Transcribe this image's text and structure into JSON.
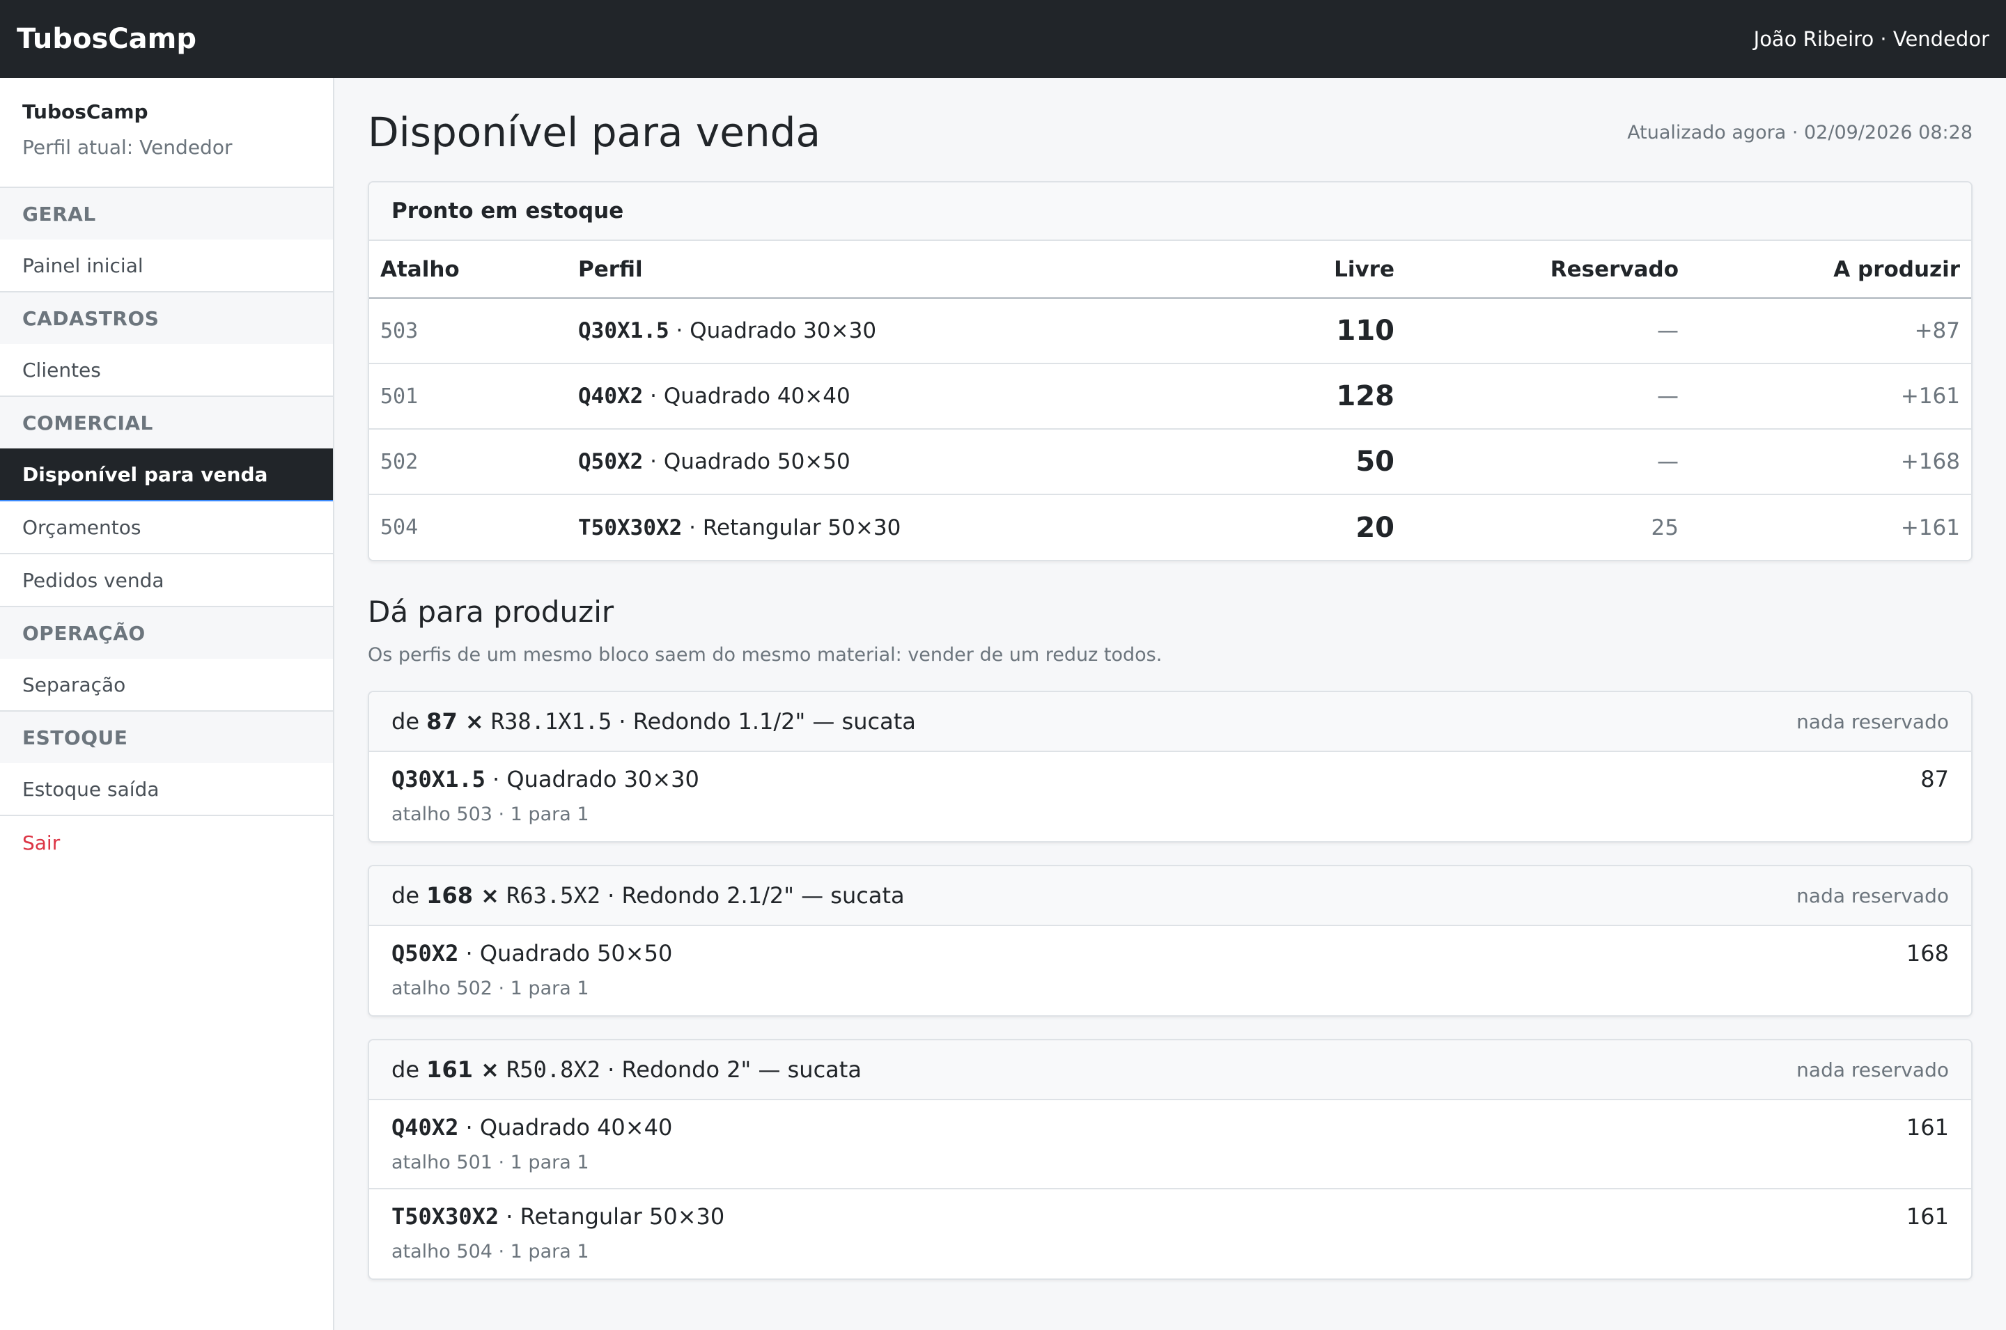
{
  "navbar": {
    "brand": "TubosCamp",
    "user": "João Ribeiro · Vendedor"
  },
  "sidebar": {
    "org": "TubosCamp",
    "role": "Perfil atual: Vendedor",
    "sections": [
      {
        "title": "GERAL",
        "items": [
          {
            "label": "Painel inicial"
          }
        ]
      },
      {
        "title": "CADASTROS",
        "items": [
          {
            "label": "Clientes"
          }
        ]
      },
      {
        "title": "COMERCIAL",
        "items": [
          {
            "label": "Disponível para venda",
            "active": true
          },
          {
            "label": "Orçamentos"
          },
          {
            "label": "Pedidos venda"
          }
        ]
      },
      {
        "title": "OPERAÇÃO",
        "items": [
          {
            "label": "Separação"
          }
        ]
      },
      {
        "title": "ESTOQUE",
        "items": [
          {
            "label": "Estoque saída"
          }
        ]
      }
    ],
    "logout": "Sair"
  },
  "page": {
    "title": "Disponível para venda",
    "updated": "Atualizado agora · 02/09/2026 08:28"
  },
  "stock": {
    "title": "Pronto em estoque",
    "columns": [
      "Atalho",
      "Perfil",
      "Livre",
      "Reservado",
      "A produzir"
    ],
    "rows": [
      {
        "shortcut": "503",
        "code": "Q30X1.5",
        "desc": " · Quadrado 30×30",
        "free": "110",
        "reserved": "—",
        "to_produce": "+87"
      },
      {
        "shortcut": "501",
        "code": "Q40X2",
        "desc": " · Quadrado 40×40",
        "free": "128",
        "reserved": "—",
        "to_produce": "+161"
      },
      {
        "shortcut": "502",
        "code": "Q50X2",
        "desc": " · Quadrado 50×50",
        "free": "50",
        "reserved": "—",
        "to_produce": "+168"
      },
      {
        "shortcut": "504",
        "code": "T50X30X2",
        "desc": " · Retangular 50×30",
        "free": "20",
        "reserved": "25",
        "to_produce": "+161"
      }
    ]
  },
  "produce": {
    "title": "Dá para produzir",
    "note": "Os perfis de um mesmo bloco saem do mesmo material: vender de um reduz todos.",
    "groups": [
      {
        "prefix": "de ",
        "qty": "87 ×",
        "material_code": "R38.1X1.5",
        "material_desc": " · Redondo 1.1/2\" — sucata",
        "tag": "nada reservado",
        "rows": [
          {
            "code": "Q30X1.5",
            "desc": " · Quadrado 30×30",
            "sub": "atalho 503 · 1 para 1",
            "qty": "87"
          }
        ]
      },
      {
        "prefix": "de ",
        "qty": "168 ×",
        "material_code": "R63.5X2",
        "material_desc": " · Redondo 2.1/2\" — sucata",
        "tag": "nada reservado",
        "rows": [
          {
            "code": "Q50X2",
            "desc": " · Quadrado 50×50",
            "sub": "atalho 502 · 1 para 1",
            "qty": "168"
          }
        ]
      },
      {
        "prefix": "de ",
        "qty": "161 ×",
        "material_code": "R50.8X2",
        "material_desc": " · Redondo 2\" — sucata",
        "tag": "nada reservado",
        "rows": [
          {
            "code": "Q40X2",
            "desc": " · Quadrado 40×40",
            "sub": "atalho 501 · 1 para 1",
            "qty": "161"
          },
          {
            "code": "T50X30X2",
            "desc": " · Retangular 50×30",
            "sub": "atalho 504 · 1 para 1",
            "qty": "161"
          }
        ]
      }
    ]
  }
}
